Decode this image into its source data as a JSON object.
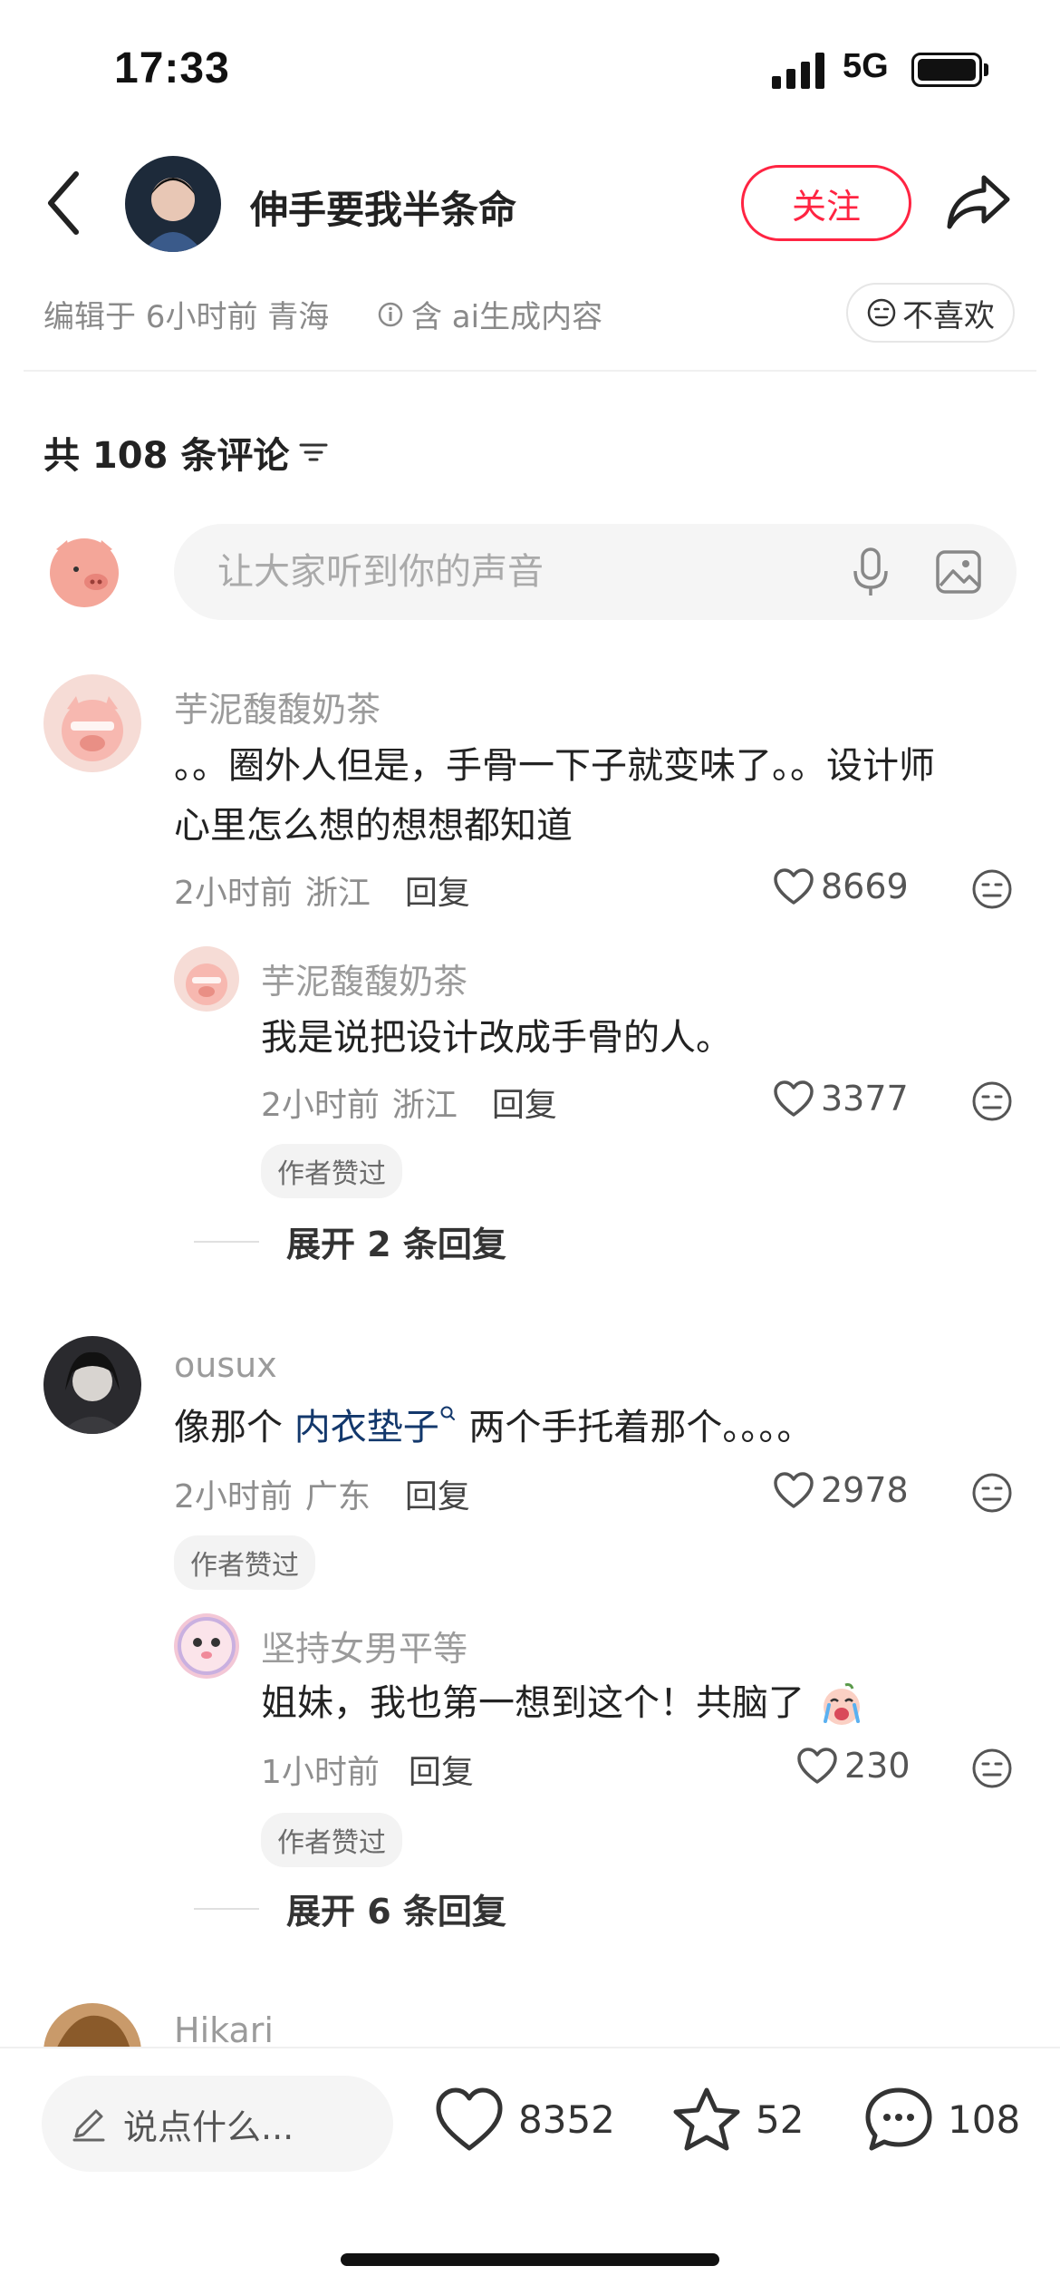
{
  "status_bar": {
    "time": "17:33",
    "network": "5G"
  },
  "header": {
    "author_name": "伸手要我半条命",
    "follow_label": "关注"
  },
  "post_meta": {
    "edited": "编辑于 6小时前 青海",
    "ai_note": "含 ai生成内容",
    "dislike_label": "不喜欢"
  },
  "comments_header": {
    "count_label": "共 108 条评论"
  },
  "input": {
    "placeholder": "让大家听到你的声音"
  },
  "comments": [
    {
      "user": "芋泥馥馥奶茶",
      "text_line1": "。。圈外人但是，手骨一下子就变味了。。设计师",
      "text_line2": "心里怎么想的想想都知道",
      "time": "2小时前",
      "location": "浙江",
      "reply_label": "回复",
      "likes": "8669",
      "replies": [
        {
          "user": "芋泥馥馥奶茶",
          "text": "我是说把设计改成手骨的人。",
          "time": "2小时前",
          "location": "浙江",
          "reply_label": "回复",
          "likes": "3377",
          "tag": "作者赞过"
        }
      ],
      "expand_label": "展开 2 条回复"
    },
    {
      "user": "ousux",
      "text_prefix": "像那个 ",
      "text_link": "内衣垫子",
      "text_suffix": " 两个手托着那个。。。。",
      "time": "2小时前",
      "location": "广东",
      "reply_label": "回复",
      "likes": "2978",
      "tag": "作者赞过",
      "replies": [
        {
          "user": "坚持女男平等",
          "text": "姐妹，我也第一想到这个！共脑了",
          "time": "1小时前",
          "reply_label": "回复",
          "likes": "230",
          "tag": "作者赞过"
        }
      ],
      "expand_label": "展开 6 条回复"
    },
    {
      "user": "Hikari"
    }
  ],
  "bottom_bar": {
    "say_placeholder": "说点什么...",
    "likes": "8352",
    "stars": "52",
    "comments": "108"
  },
  "colors": {
    "accent": "#ff2442",
    "link": "#13386c",
    "muted": "#8e8e8e"
  },
  "icons": [
    "back-icon",
    "share-icon",
    "info-icon",
    "neutral-face-icon",
    "filter-icon",
    "mic-icon",
    "image-icon",
    "heart-icon",
    "star-icon",
    "chat-bubble-icon",
    "pencil-icon",
    "search-small-icon"
  ]
}
